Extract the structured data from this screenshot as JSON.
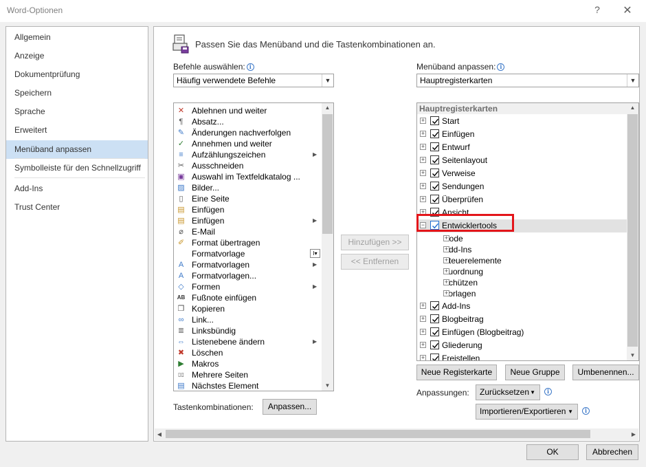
{
  "window": {
    "title": "Word-Optionen",
    "help": "?",
    "close": "✕"
  },
  "sidebar": {
    "items": [
      {
        "label": "Allgemein"
      },
      {
        "label": "Anzeige"
      },
      {
        "label": "Dokumentprüfung"
      },
      {
        "label": "Speichern"
      },
      {
        "label": "Sprache"
      },
      {
        "label": "Erweitert"
      },
      {
        "label": "Menüband anpassen",
        "active": true
      },
      {
        "label": "Symbolleiste für den Schnellzugriff"
      },
      {
        "label": "Add-Ins"
      },
      {
        "label": "Trust Center"
      }
    ]
  },
  "main": {
    "heading": "Passen Sie das Menüband und die Tastenkombinationen an.",
    "commands_label": "Befehle auswählen:",
    "commands_select": "Häufig verwendete Befehle",
    "ribbon_label": "Menüband anpassen:",
    "ribbon_select": "Hauptregisterkarten",
    "commands": [
      {
        "label": "Ablehnen und weiter",
        "icon": "reject-icon"
      },
      {
        "label": "Absatz...",
        "icon": "paragraph-icon"
      },
      {
        "label": "Änderungen nachverfolgen",
        "icon": "track-changes-icon"
      },
      {
        "label": "Annehmen und weiter",
        "icon": "accept-icon"
      },
      {
        "label": "Aufzählungszeichen",
        "icon": "bullets-icon",
        "submenu": true
      },
      {
        "label": "Ausschneiden",
        "icon": "scissors-icon"
      },
      {
        "label": "Auswahl im Textfeldkatalog ...",
        "icon": "save-icon"
      },
      {
        "label": "Bilder...",
        "icon": "picture-icon"
      },
      {
        "label": "Eine Seite",
        "icon": "page-icon"
      },
      {
        "label": "Einfügen",
        "icon": "paste-icon"
      },
      {
        "label": "Einfügen",
        "icon": "paste-icon",
        "submenu": true
      },
      {
        "label": "E-Mail",
        "icon": "attach-icon"
      },
      {
        "label": "Format übertragen",
        "icon": "brush-icon"
      },
      {
        "label": "Formatvorlage",
        "icon": "blank-icon",
        "control": "I▾"
      },
      {
        "label": "Formatvorlagen",
        "icon": "styles-icon",
        "submenu": true
      },
      {
        "label": "Formatvorlagen...",
        "icon": "styles-dialog-icon"
      },
      {
        "label": "Formen",
        "icon": "shapes-icon",
        "submenu": true
      },
      {
        "label": "Fußnote einfügen",
        "icon": "footnote-icon"
      },
      {
        "label": "Kopieren",
        "icon": "copy-icon"
      },
      {
        "label": "Link...",
        "icon": "link-icon"
      },
      {
        "label": "Linksbündig",
        "icon": "align-left-icon"
      },
      {
        "label": "Listenebene ändern",
        "icon": "list-level-icon",
        "submenu": true
      },
      {
        "label": "Löschen",
        "icon": "delete-icon"
      },
      {
        "label": "Makros",
        "icon": "play-icon"
      },
      {
        "label": "Mehrere Seiten",
        "icon": "multi-page-icon"
      },
      {
        "label": "Nächstes Element",
        "icon": "next-icon"
      }
    ],
    "add_button": "Hinzufügen >>",
    "remove_button": "<< Entfernen",
    "tree_header": "Hauptregisterkarten",
    "tabs": [
      {
        "label": "Start",
        "checked": true
      },
      {
        "label": "Einfügen",
        "checked": true
      },
      {
        "label": "Entwurf",
        "checked": true
      },
      {
        "label": "Seitenlayout",
        "checked": true
      },
      {
        "label": "Verweise",
        "checked": true
      },
      {
        "label": "Sendungen",
        "checked": true
      },
      {
        "label": "Überprüfen",
        "checked": true
      },
      {
        "label": "Ansicht",
        "checked": true
      },
      {
        "label": "Entwicklertools",
        "checked": true,
        "expanded": true,
        "selected": true,
        "children": [
          "Code",
          "Add-Ins",
          "Steuerelemente",
          "Zuordnung",
          "Schützen",
          "Vorlagen"
        ]
      },
      {
        "label": "Add-Ins",
        "checked": true
      },
      {
        "label": "Blogbeitrag",
        "checked": true
      },
      {
        "label": "Einfügen (Blogbeitrag)",
        "checked": true
      },
      {
        "label": "Gliederung",
        "checked": true
      },
      {
        "label": "Freistellen",
        "checked": true
      }
    ],
    "new_tab_button": "Neue Registerkarte",
    "new_group_button": "Neue Gruppe",
    "rename_button": "Umbenennen...",
    "customizations_label": "Anpassungen:",
    "reset_button": "Zurücksetzen",
    "import_export_button": "Importieren/Exportieren",
    "shortcuts_label": "Tastenkombinationen:",
    "customize_button": "Anpassen..."
  },
  "footer": {
    "ok": "OK",
    "cancel": "Abbrechen"
  },
  "colors": {
    "highlight_border": "#e3151a",
    "active_nav": "#cce0f4",
    "info_blue": "#3c78c8"
  }
}
